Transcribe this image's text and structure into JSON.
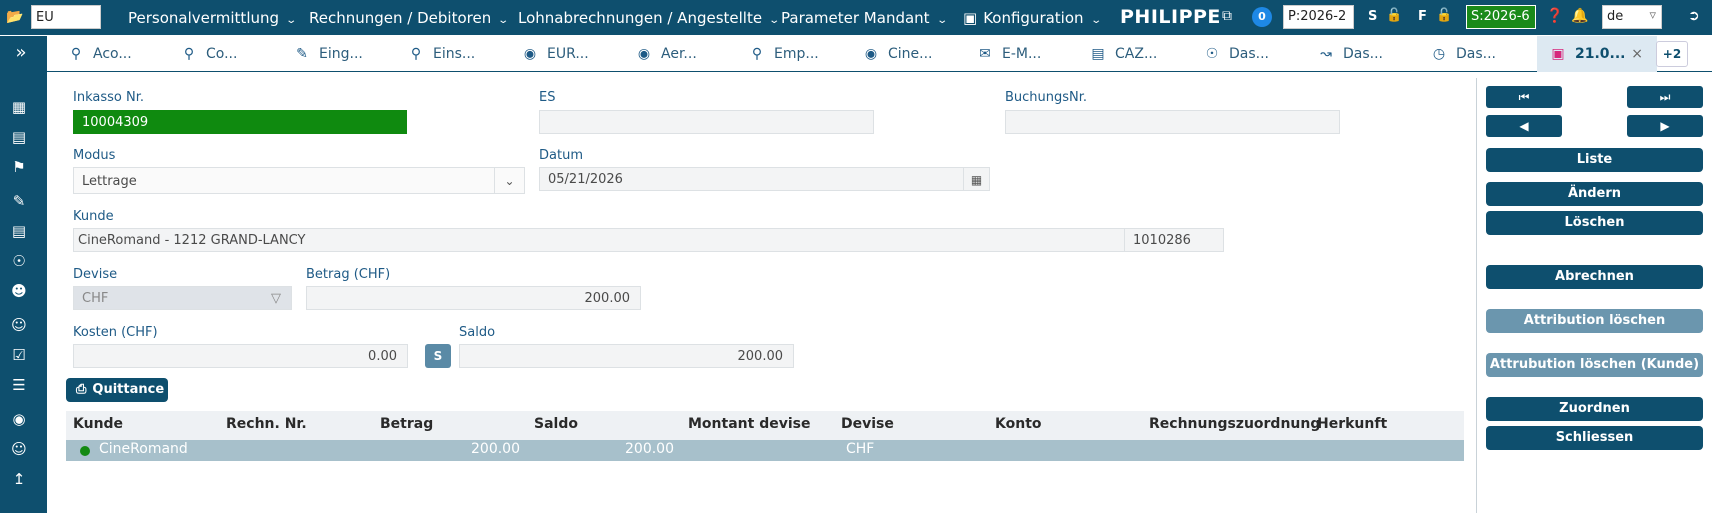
{
  "topbar": {
    "search_value": "EU",
    "menus": [
      "Personalvermittlung",
      "Rechnungen / Debitoren",
      "Lohnabrechnungen / Angestellte",
      "Parameter Mandant",
      "Konfiguration"
    ],
    "user": "PHILIPPE",
    "badge_count": "0",
    "period_p": "P:2026-2",
    "letter_s": "S",
    "letter_f": "F",
    "period_s": "S:2026-6",
    "language": "de",
    "colors": {
      "bar": "#0e4f6e",
      "period_s_bg": "#1a8a1a"
    }
  },
  "tabs": [
    {
      "label": "Aco...",
      "icon": "search-icon"
    },
    {
      "label": "Co...",
      "icon": "search-icon"
    },
    {
      "label": "Eing...",
      "icon": "pencil-icon"
    },
    {
      "label": "Eins...",
      "icon": "search-icon"
    },
    {
      "label": "EUR...",
      "icon": "binoculars-icon"
    },
    {
      "label": "Aer...",
      "icon": "binoculars-icon"
    },
    {
      "label": "Emp...",
      "icon": "search-icon"
    },
    {
      "label": "Cine...",
      "icon": "binoculars-icon"
    },
    {
      "label": "E-M...",
      "icon": "envelope-icon"
    },
    {
      "label": "CAZ...",
      "icon": "id-card-icon"
    },
    {
      "label": "Das...",
      "icon": "hand-coin-icon"
    },
    {
      "label": "Das...",
      "icon": "chart-line-icon"
    },
    {
      "label": "Das...",
      "icon": "clock-icon"
    },
    {
      "label": "21.0...",
      "icon": "cash-register-icon",
      "active": true
    }
  ],
  "tab_more": "+2",
  "form": {
    "inkasso_label": "Inkasso Nr.",
    "inkasso_value": "10004309",
    "es_label": "ES",
    "es_value": "",
    "buchung_label": "BuchungsNr.",
    "buchung_value": "",
    "modus_label": "Modus",
    "modus_value": "Lettrage",
    "datum_label": "Datum",
    "datum_value": "05/21/2026",
    "kunde_label": "Kunde",
    "kunde_value": "CineRomand - 1212 GRAND-LANCY",
    "kunde_nr": "1010286",
    "devise_label": "Devise",
    "devise_value": "CHF",
    "betrag_label": "Betrag (CHF)",
    "betrag_value": "200.00",
    "kosten_label": "Kosten (CHF)",
    "kosten_value": "0.00",
    "s_button": "S",
    "saldo_label": "Saldo",
    "saldo_value": "200.00",
    "quittance_label": "Quittance"
  },
  "table": {
    "columns": [
      "Kunde",
      "Rechn. Nr.",
      "Betrag",
      "Saldo",
      "Montant devise",
      "Devise",
      "Konto",
      "Rechnungszuordnung",
      "Herkunft"
    ],
    "rows": [
      {
        "kunde": "CineRomand",
        "rechn_nr": "",
        "betrag": "200.00",
        "saldo": "200.00",
        "montant_devise": "",
        "devise": "CHF",
        "konto": "",
        "zuordnung": "",
        "herkunft": ""
      }
    ]
  },
  "actions": {
    "liste": "Liste",
    "aendern": "Ändern",
    "loeschen": "Löschen",
    "abrechnen": "Abrechnen",
    "attribution_loeschen": "Attribution löschen",
    "attribution_loeschen_kunde": "Attrubution löschen (Kunde)",
    "zuordnen": "Zuordnen",
    "schliessen": "Schliessen"
  }
}
